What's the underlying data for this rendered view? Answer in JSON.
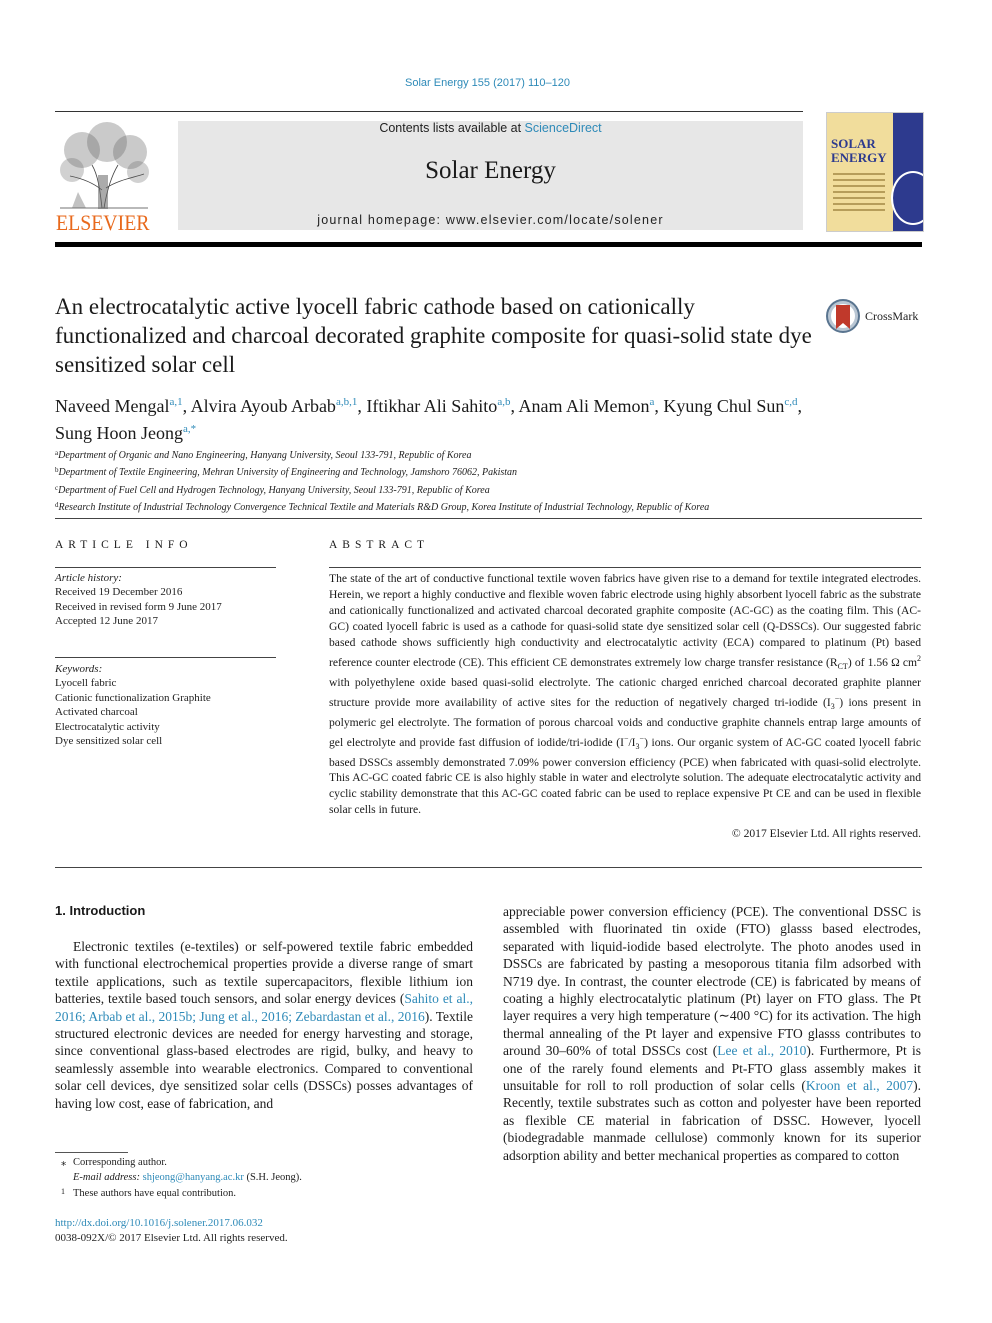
{
  "header": {
    "citation": "Solar Energy 155 (2017) 110–120",
    "contents_prefix": "Contents lists available at ",
    "contents_link": "ScienceDirect",
    "journal_name": "Solar Energy",
    "homepage": "journal homepage: www.elsevier.com/locate/solener",
    "publisher_logo_text": "ELSEVIER",
    "cover_title_line1": "SOLAR",
    "cover_title_line2": "ENERGY",
    "colors": {
      "link": "#2e8ab8",
      "elsevier_orange": "#e8691c",
      "cover_yellow": "#f1dd9c",
      "cover_blue": "#2d3a8e"
    }
  },
  "article": {
    "title": "An electrocatalytic active lyocell fabric cathode based on cationically functionalized and charcoal decorated graphite composite for quasi-solid state dye sensitized solar cell",
    "crossmark_label": "CrossMark",
    "authors": [
      {
        "name": "Naveed Mengal",
        "sup": "a,1",
        "sep": ", "
      },
      {
        "name": "Alvira Ayoub Arbab",
        "sup": "a,b,1",
        "sep": ", "
      },
      {
        "name": "Iftikhar Ali Sahito",
        "sup": "a,b",
        "sep": ", "
      },
      {
        "name": "Anam Ali Memon",
        "sup": "a",
        "sep": ", "
      },
      {
        "name": "Kyung Chul Sun",
        "sup": "c,d",
        "sep": ","
      },
      {
        "name": "Sung Hoon Jeong",
        "sup": "a,*",
        "sep": ""
      }
    ],
    "affiliations": [
      {
        "key": "a",
        "text": "Department of Organic and Nano Engineering, Hanyang University, Seoul 133-791, Republic of Korea"
      },
      {
        "key": "b",
        "text": "Department of Textile Engineering, Mehran University of Engineering and Technology, Jamshoro 76062, Pakistan"
      },
      {
        "key": "c",
        "text": "Department of Fuel Cell and Hydrogen Technology, Hanyang University, Seoul 133-791, Republic of Korea"
      },
      {
        "key": "d",
        "text": "Research Institute of Industrial Technology Convergence Technical Textile and Materials R&D Group, Korea Institute of Industrial Technology, Republic of Korea"
      }
    ]
  },
  "article_info": {
    "heading": "ARTICLE INFO",
    "history_label": "Article history:",
    "history": [
      "Received 19 December 2016",
      "Received in revised form 9 June 2017",
      "Accepted 12 June 2017"
    ],
    "keywords_label": "Keywords:",
    "keywords": [
      "Lyocell fabric",
      "Cationic functionalization Graphite",
      "Activated charcoal",
      "Electrocatalytic activity",
      "Dye sensitized solar cell"
    ]
  },
  "abstract": {
    "heading": "ABSTRACT",
    "p1": "The state of the art of conductive functional textile woven fabrics have given rise to a demand for textile integrated electrodes. Herein, we report a highly conductive and flexible woven fabric electrode using highly absorbent lyocell fabric as the substrate and cationically functionalized and activated charcoal decorated graphite composite (AC-GC) as the coating film. This (AC-GC) coated lyocell fabric is used as a cathode for quasi-solid state dye sensitized solar cell (Q-DSSCs). Our suggested fabric based cathode shows sufficiently high conductivity and electrocatalytic activity (ECA) compared to platinum (Pt) based reference counter electrode (CE). This efficient CE demonstrates extremely low charge transfer resistance (R",
    "rct_sub": "CT",
    "p2": ") of 1.56 Ω cm",
    "cm_sup": "2",
    "p3": " with polyethylene oxide based quasi-solid electrolyte. The cationic charged enriched charcoal decorated graphite planner structure provide more availability of active sites for the reduction of negatively charged tri-iodide (I",
    "i3_sub": "3",
    "i3_sup": "−",
    "p4": ") ions present in polymeric gel electrolyte. The formation of porous charcoal voids and conductive graphite channels entrap large amounts of gel electrolyte and provide fast diffusion of iodide/tri-iodide (I",
    "p5": "/I",
    "p6": ") ions. Our organic system of AC-GC coated lyocell fabric based DSSCs assembly demonstrated 7.09% power conversion efficiency (PCE) when fabricated with quasi-solid electrolyte. This AC-GC coated fabric CE is also highly stable in water and electrolyte solution. The adequate electrocatalytic activity and cyclic stability demonstrate that this AC-GC coated fabric can be used to replace expensive Pt CE and can be used in flexible solar cells in future.",
    "copyright": "© 2017 Elsevier Ltd. All rights reserved."
  },
  "body": {
    "section_heading": "1. Introduction",
    "left_p1": "Electronic textiles (e-textiles) or self-powered textile fabric embedded with functional electrochemical properties provide a diverse range of smart textile applications, such as textile supercapacitors, flexible lithium ion batteries, textile based touch sensors, and solar energy devices (",
    "left_refs": "Sahito et al., 2016; Arbab et al., 2015b; Jung et al., 2016; Zebardastan et al., 2016",
    "left_p2": "). Textile structured electronic devices are needed for energy harvesting and storage, since conventional glass-based electrodes are rigid, bulky, and heavy to seamlessly assemble into wearable electronics. Compared to conventional solar cell devices, dye sensitized solar cells (DSSCs) posses advantages of having low cost, ease of fabrication, and",
    "right_p1": "appreciable power conversion efficiency (PCE). The conventional DSSC is assembled with fluorinated tin oxide (FTO) glasss based electrodes, separated with liquid-iodide based electrolyte. The photo anodes used in DSSCs are fabricated by pasting a mesoporous titania film adsorbed with N719 dye. In contrast, the counter electrode (CE) is fabricated by means of coating a highly electrocatalytic platinum (Pt) layer on FTO glass. The Pt layer requires a very high temperature (∼400 °C) for its activation. The high thermal annealing of the Pt layer and expensive FTO glasss contributes to around 30–60% of total DSSCs cost (",
    "right_ref1": "Lee et al., 2010",
    "right_p2": "). Furthermore, Pt is one of the rarely found elements and Pt-FTO glass assembly makes it unsuitable for roll to roll production of solar cells (",
    "right_ref2": "Kroon et al., 2007",
    "right_p3": "). Recently, textile substrates such as cotton and polyester have been reported as flexible CE material in fabrication of DSSC. However, lyocell (biodegradable manmade cellulose) commonly known for its superior adsorption ability and better mechanical properties as compared to cotton"
  },
  "footnotes": {
    "corr_mark": "⁎",
    "corr_text": "Corresponding author.",
    "email_label": "E-mail address: ",
    "email": "shjeong@hanyang.ac.kr",
    "email_suffix": " (S.H. Jeong).",
    "equal_mark": "1",
    "equal_text": "These authors have equal contribution.",
    "doi": "http://dx.doi.org/10.1016/j.solener.2017.06.032",
    "issn_line": "0038-092X/© 2017 Elsevier Ltd. All rights reserved."
  }
}
